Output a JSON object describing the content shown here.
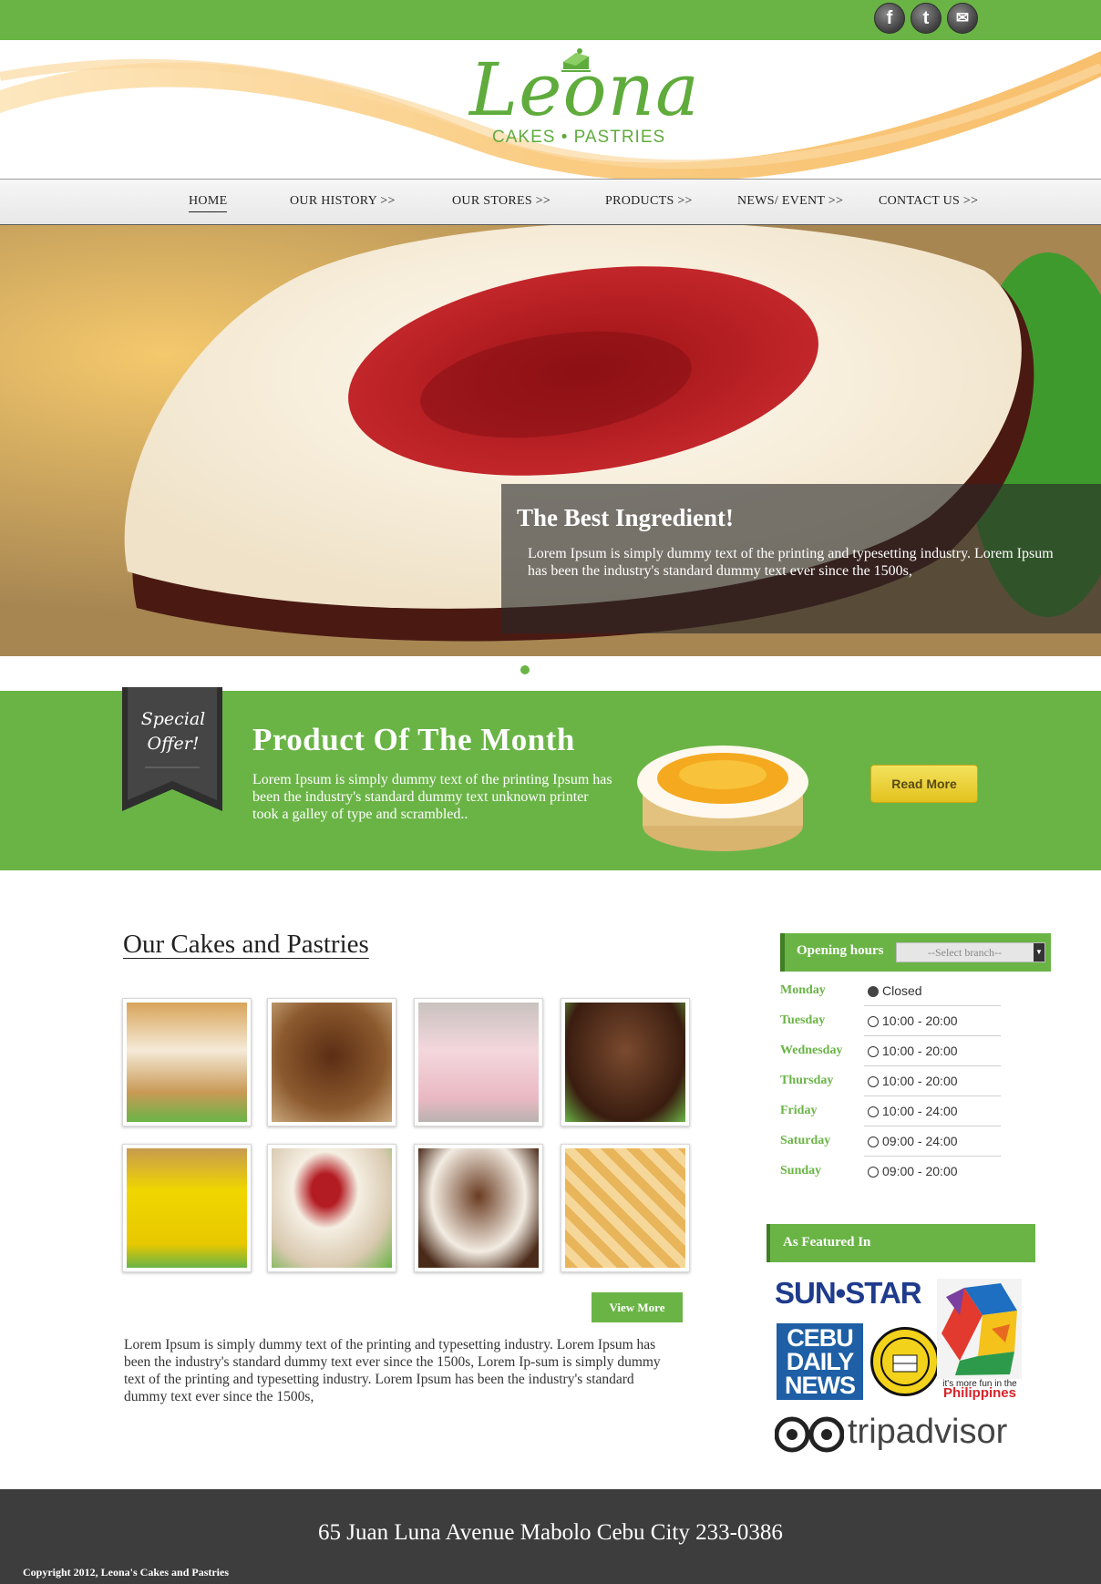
{
  "social": [
    {
      "name": "facebook",
      "glyph": "f"
    },
    {
      "name": "twitter",
      "glyph": "t"
    },
    {
      "name": "mail",
      "glyph": "✉"
    }
  ],
  "brand": {
    "name": "Leona",
    "tagline": "CAKES • PASTRIES",
    "accent": "#6ab446"
  },
  "nav": {
    "items": [
      {
        "label": "HOME",
        "active": true
      },
      {
        "label": "OUR HISTORY >>"
      },
      {
        "label": "OUR STORES >>"
      },
      {
        "label": "PRODUCTS >>"
      },
      {
        "label": "NEWS/ EVENT >>"
      },
      {
        "label": "CONTACT US >>"
      }
    ]
  },
  "hero": {
    "title": "The Best Ingredient!",
    "text": "Lorem Ipsum is simply dummy text of the printing and typesetting industry. Lorem Ipsum has been the industry's standard dummy text ever since the 1500s,"
  },
  "potm": {
    "ribbon": "Special Offer!",
    "title": "Product Of The Month",
    "text": "Lorem Ipsum is simply dummy text of the printing Ipsum has been the industry's standard dummy text unknown printer took a galley of type and scrambled..",
    "button": "Read More"
  },
  "cakes": {
    "title": "Our Cakes and Pastries",
    "button": "View More",
    "text": "Lorem Ipsum is simply dummy text of the printing and typesetting industry. Lorem Ipsum has been the industry's standard dummy text ever since the 1500s, Lorem Ip-sum is simply dummy text of the printing and typesetting industry. Lorem Ipsum has been the industry's standard dummy text ever since the 1500s,"
  },
  "hours": {
    "title": "Opening hours",
    "select_placeholder": "--Select branch--",
    "rows": [
      {
        "day": "Monday",
        "time": "Closed"
      },
      {
        "day": "Tuesday",
        "time": "10:00 - 20:00"
      },
      {
        "day": "Wednesday",
        "time": "10:00 - 20:00"
      },
      {
        "day": "Thursday",
        "time": "10:00 - 20:00"
      },
      {
        "day": "Friday",
        "time": "10:00 - 24:00"
      },
      {
        "day": "Saturday",
        "time": "09:00 - 24:00"
      },
      {
        "day": "Sunday",
        "time": "09:00 - 20:00"
      }
    ]
  },
  "featured": {
    "title": "As Featured In",
    "sunstar": "SUN•STAR",
    "cebu": "CEBU DAILY NEWS",
    "phil_small": "it's more fun in the",
    "phil_big": "Philippines",
    "trip": "tripadvisor"
  },
  "footer": {
    "address": "65 Juan Luna Avenue Mabolo Cebu City 233-0386",
    "copyright": "Copyright 2012, Leona's Cakes and Pastries"
  }
}
